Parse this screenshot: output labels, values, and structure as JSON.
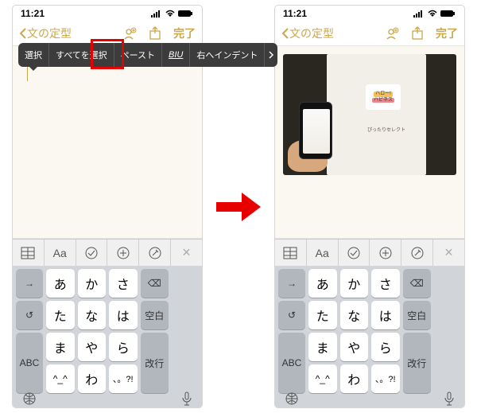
{
  "statusbar": {
    "time": "11:21"
  },
  "navbar": {
    "back_label": "文の定型",
    "done_label": "完了"
  },
  "context_menu": {
    "select": "選択",
    "select_all": "すべてを選択",
    "paste": "ペースト",
    "biu": "BIU",
    "indent_right": "右へインデント"
  },
  "toolbar": {
    "aa": "Aa"
  },
  "keyboard": {
    "rows": [
      [
        "あ",
        "か",
        "さ"
      ],
      [
        "た",
        "な",
        "は"
      ],
      [
        "ま",
        "や",
        "ら"
      ],
      [
        "^_^",
        "わ",
        "、。?!"
      ]
    ],
    "side": {
      "arrow": "→",
      "undo": "↺",
      "abc": "ABC"
    },
    "right": {
      "backspace": "⌫",
      "space": "空白",
      "enter": "改行"
    }
  },
  "pasted_image": {
    "badge_top": "ハロー!",
    "badge_bottom": "ハピネス",
    "caption": "ぴったりセレクト"
  }
}
